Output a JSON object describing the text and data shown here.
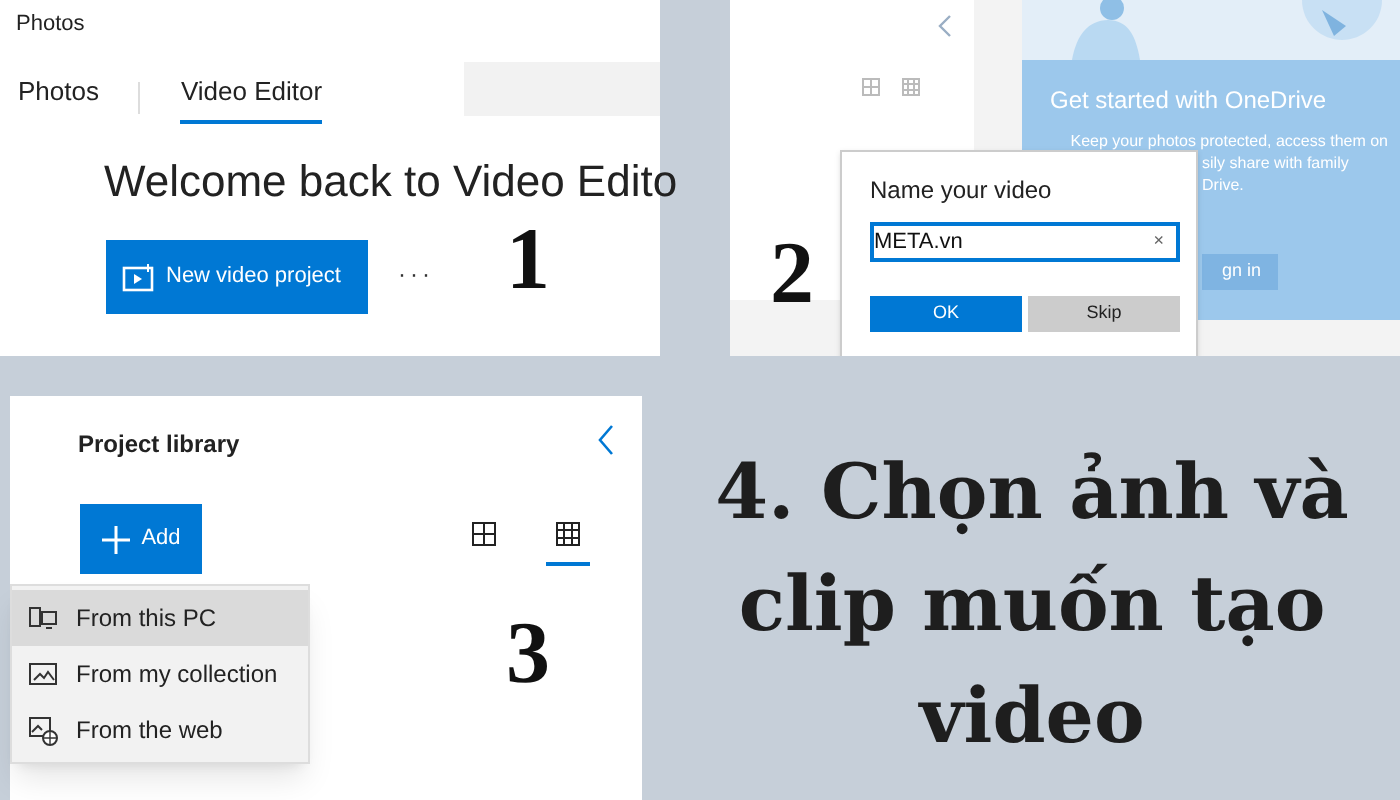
{
  "step1": {
    "app_title": "Photos",
    "tabs": [
      {
        "label": "Photos",
        "selected": false
      },
      {
        "label": "Video Editor",
        "selected": true
      }
    ],
    "heading": "Welcome back to Video Edito",
    "new_button": "New video project",
    "more": "···",
    "number": "1"
  },
  "step2": {
    "onedrive": {
      "title": "Get started with OneDrive",
      "text_lines": [
        "Keep your photos protected, access them on",
        "sily share with family",
        "Drive."
      ],
      "button": "gn in"
    },
    "dialog": {
      "title": "Name your video",
      "value": "META.vn",
      "clear": "×",
      "buttons": [
        {
          "label": "OK",
          "kind": "primary"
        },
        {
          "label": "Skip",
          "kind": "secondary"
        }
      ]
    },
    "number": "2"
  },
  "step3": {
    "title": "Project library",
    "add_button": "Add",
    "views": [
      {
        "kind": "large",
        "selected": false
      },
      {
        "kind": "small",
        "selected": true
      }
    ],
    "menu": [
      {
        "label": "From this PC",
        "kind": "pc",
        "selected": true
      },
      {
        "label": "From my collection",
        "kind": "collection",
        "selected": false
      },
      {
        "label": "From the web",
        "kind": "web",
        "selected": false
      }
    ],
    "number": "3"
  },
  "caption": "4. Chọn ảnh và clip muốn tạo video"
}
